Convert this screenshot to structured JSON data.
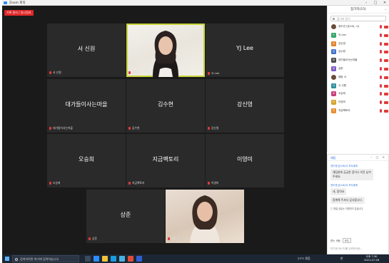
{
  "window": {
    "title": "Zoom 회의"
  },
  "recording": {
    "label": "기록 중지 / 일시정지"
  },
  "tiles": [
    {
      "name": "서 신원",
      "label": "서 신원"
    },
    {
      "name": "",
      "label": "권도연"
    },
    {
      "name": "YJ Lee",
      "label": "YJ Lee"
    },
    {
      "name": "대가들이사는마을",
      "label": "대가들이사는마을"
    },
    {
      "name": "김수현",
      "label": "김수현"
    },
    {
      "name": "강신영",
      "label": "강신영"
    },
    {
      "name": "오승희",
      "label": "오승희"
    },
    {
      "name": "지금팩토리",
      "label": "지금팩토리"
    },
    {
      "name": "이영미",
      "label": "이영미"
    },
    {
      "name": "상준",
      "label": "상준"
    },
    {
      "name": "",
      "label": "채윤 서"
    }
  ],
  "participants_panel": {
    "title": "참가자(15)",
    "search_placeholder": "참가자 찾기",
    "items": [
      {
        "initial": "",
        "name": "권도연 (호스트, 나)",
        "color": "#6b4a3a",
        "photo": true
      },
      {
        "initial": "Y",
        "name": "YJ Lee",
        "color": "#39a86b",
        "photo": false
      },
      {
        "initial": "강",
        "name": "강신영",
        "color": "#e0802a",
        "photo": false
      },
      {
        "initial": "김",
        "name": "김수현",
        "color": "#3f6fc7",
        "photo": false
      },
      {
        "initial": "대",
        "name": "대가들이사는마을",
        "color": "#4a4a4a",
        "photo": false
      },
      {
        "initial": "상",
        "name": "상준",
        "color": "#7a5bc4",
        "photo": false
      },
      {
        "initial": "",
        "name": "채윤 서",
        "color": "#6b4a3a",
        "photo": true
      },
      {
        "initial": "서",
        "name": "서 신원",
        "color": "#2f8f9a",
        "photo": false
      },
      {
        "initial": "오",
        "name": "오승희",
        "color": "#c93f7a",
        "photo": false
      },
      {
        "initial": "이",
        "name": "이영미",
        "color": "#d6a22a",
        "photo": false
      },
      {
        "initial": "지",
        "name": "지금팩토리",
        "color": "#e88a2a",
        "photo": false
      }
    ]
  },
  "chat": {
    "title": "채팅",
    "messages": [
      {
        "sender": "권도연(호스트)이 모두에게",
        "text": "채팅창에 궁금한 점이나 의견 남겨주세요."
      },
      {
        "sender": "권도연(호스트)이 모두에게",
        "text": "네, 맞아요"
      },
      {
        "sender": "",
        "text": "함께해 주셔서 감사합니다."
      }
    ],
    "file_note": "파일 공유는 지원되지 않습니다.",
    "to_label": "받는 사람:",
    "to_value": "모두",
    "input_placeholder": "여기에 메시지를 입력하세요..."
  },
  "taskbar": {
    "search_placeholder": "검색하려면 여기에 입력하십시오.",
    "weather": "23°C  맑음",
    "language": "한",
    "time": "오후 7:30",
    "date": "2021-07-28"
  }
}
